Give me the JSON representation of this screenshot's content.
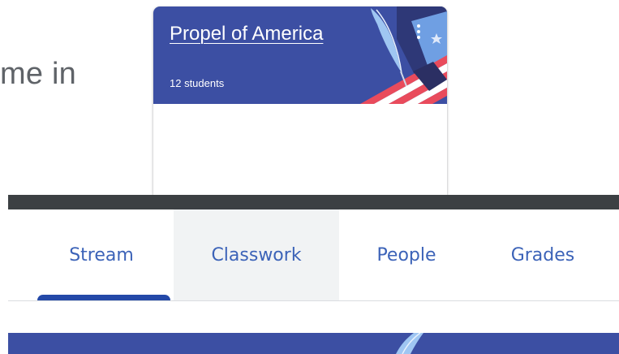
{
  "background_text": "me in",
  "class_card": {
    "title": "Propel of America",
    "subtitle": "12 students",
    "header_color": "#3c4fa3",
    "menu_icon": "more-vert-icon"
  },
  "tabs": [
    {
      "label": "Stream",
      "active": true
    },
    {
      "label": "Classwork",
      "hovered": true
    },
    {
      "label": "People"
    },
    {
      "label": "Grades"
    }
  ],
  "colors": {
    "accent": "#2449a8",
    "tab_text": "#3c63b8",
    "banner": "#3c4fa3",
    "dark_bar": "#3c4043"
  }
}
